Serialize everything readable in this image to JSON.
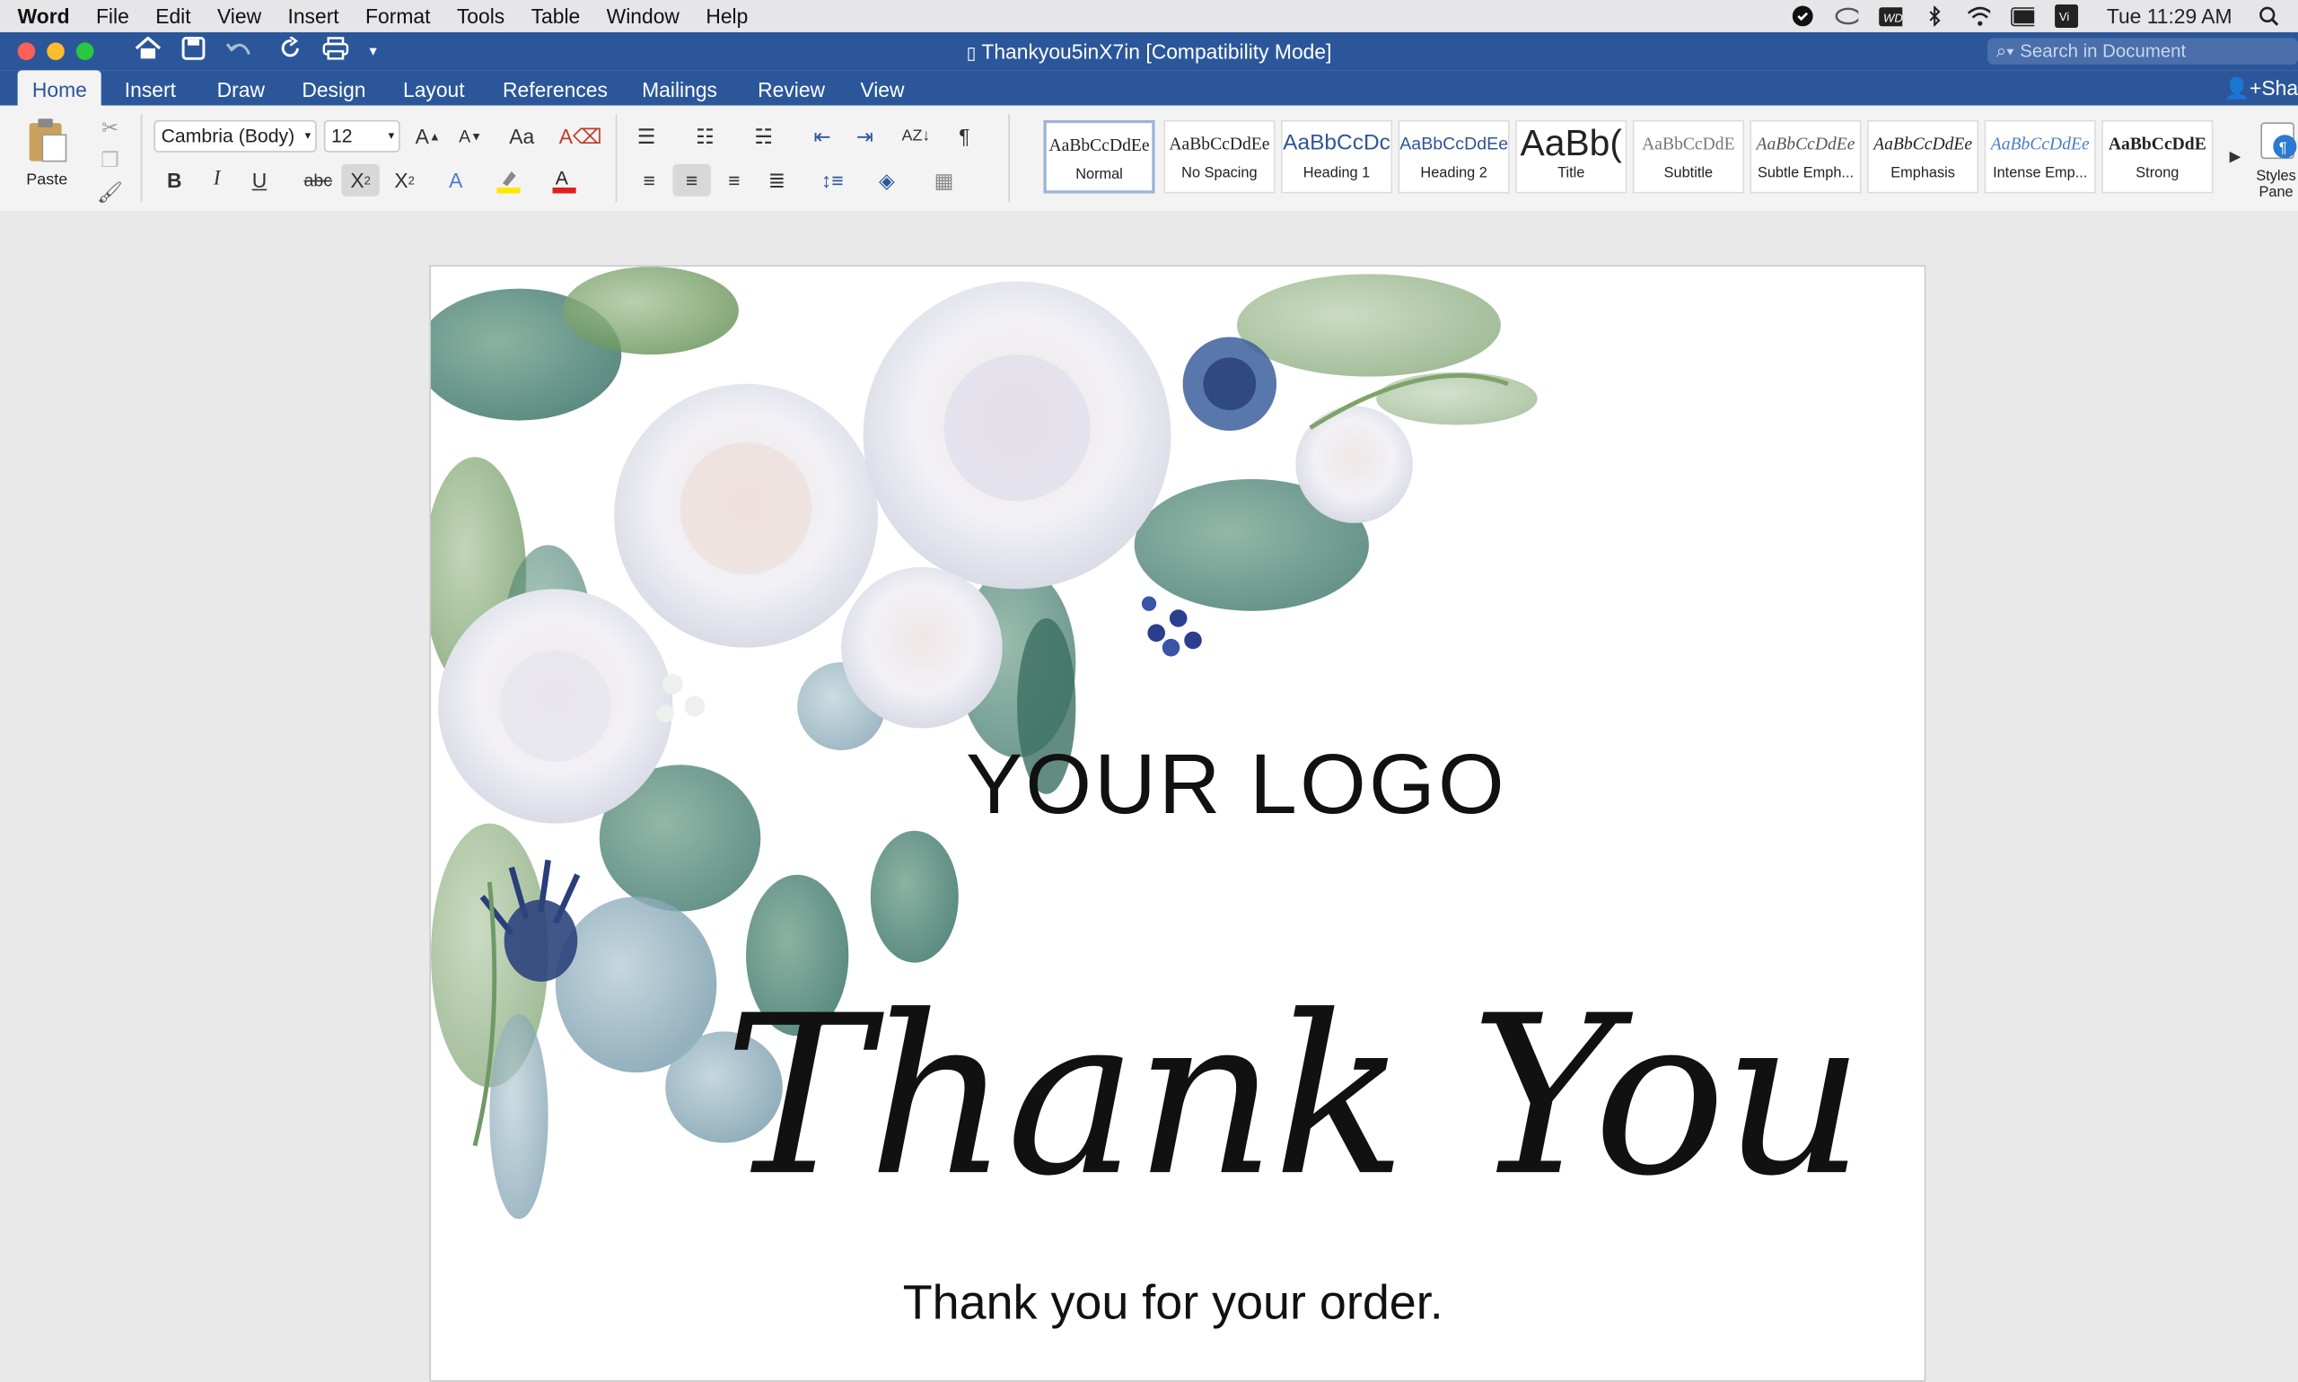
{
  "menubar": {
    "app": "Word",
    "items": [
      "File",
      "Edit",
      "View",
      "Insert",
      "Format",
      "Tools",
      "Table",
      "Window",
      "Help"
    ],
    "clock": "Tue 11:29 AM",
    "status_icons": [
      "dropbox-icon",
      "creative-cloud-icon",
      "wd-icon",
      "bluetooth-icon",
      "wifi-icon",
      "battery-icon",
      "input-source-icon",
      "spotlight-icon"
    ]
  },
  "window": {
    "title": "Thankyou5inX7in [Compatibility Mode]",
    "search_placeholder": "Search in Document"
  },
  "ribbon_tabs": [
    "Home",
    "Insert",
    "Draw",
    "Design",
    "Layout",
    "References",
    "Mailings",
    "Review",
    "View"
  ],
  "share_label": "Sha",
  "home": {
    "paste_label": "Paste",
    "font_name": "Cambria (Body)",
    "font_size": "12",
    "styles": [
      {
        "sample": "AaBbCcDdEe",
        "label": "Normal"
      },
      {
        "sample": "AaBbCcDdEe",
        "label": "No Spacing"
      },
      {
        "sample": "AaBbCcDc",
        "label": "Heading 1"
      },
      {
        "sample": "AaBbCcDdEe",
        "label": "Heading 2"
      },
      {
        "sample": "AaBb(",
        "label": "Title"
      },
      {
        "sample": "AaBbCcDdE",
        "label": "Subtitle"
      },
      {
        "sample": "AaBbCcDdEe",
        "label": "Subtle Emph..."
      },
      {
        "sample": "AaBbCcDdEe",
        "label": "Emphasis"
      },
      {
        "sample": "AaBbCcDdEe",
        "label": "Intense Emp..."
      },
      {
        "sample": "AaBbCcDdE",
        "label": "Strong"
      }
    ],
    "styles_pane_label": "Styles Pane"
  },
  "document": {
    "logo_text": "YOUR LOGO",
    "headline": "Thank You",
    "subtext": "Thank you for your order."
  },
  "colors": {
    "title_bar": "#2b579a",
    "highlight": "#ffe600",
    "font_color": "#e02020"
  }
}
